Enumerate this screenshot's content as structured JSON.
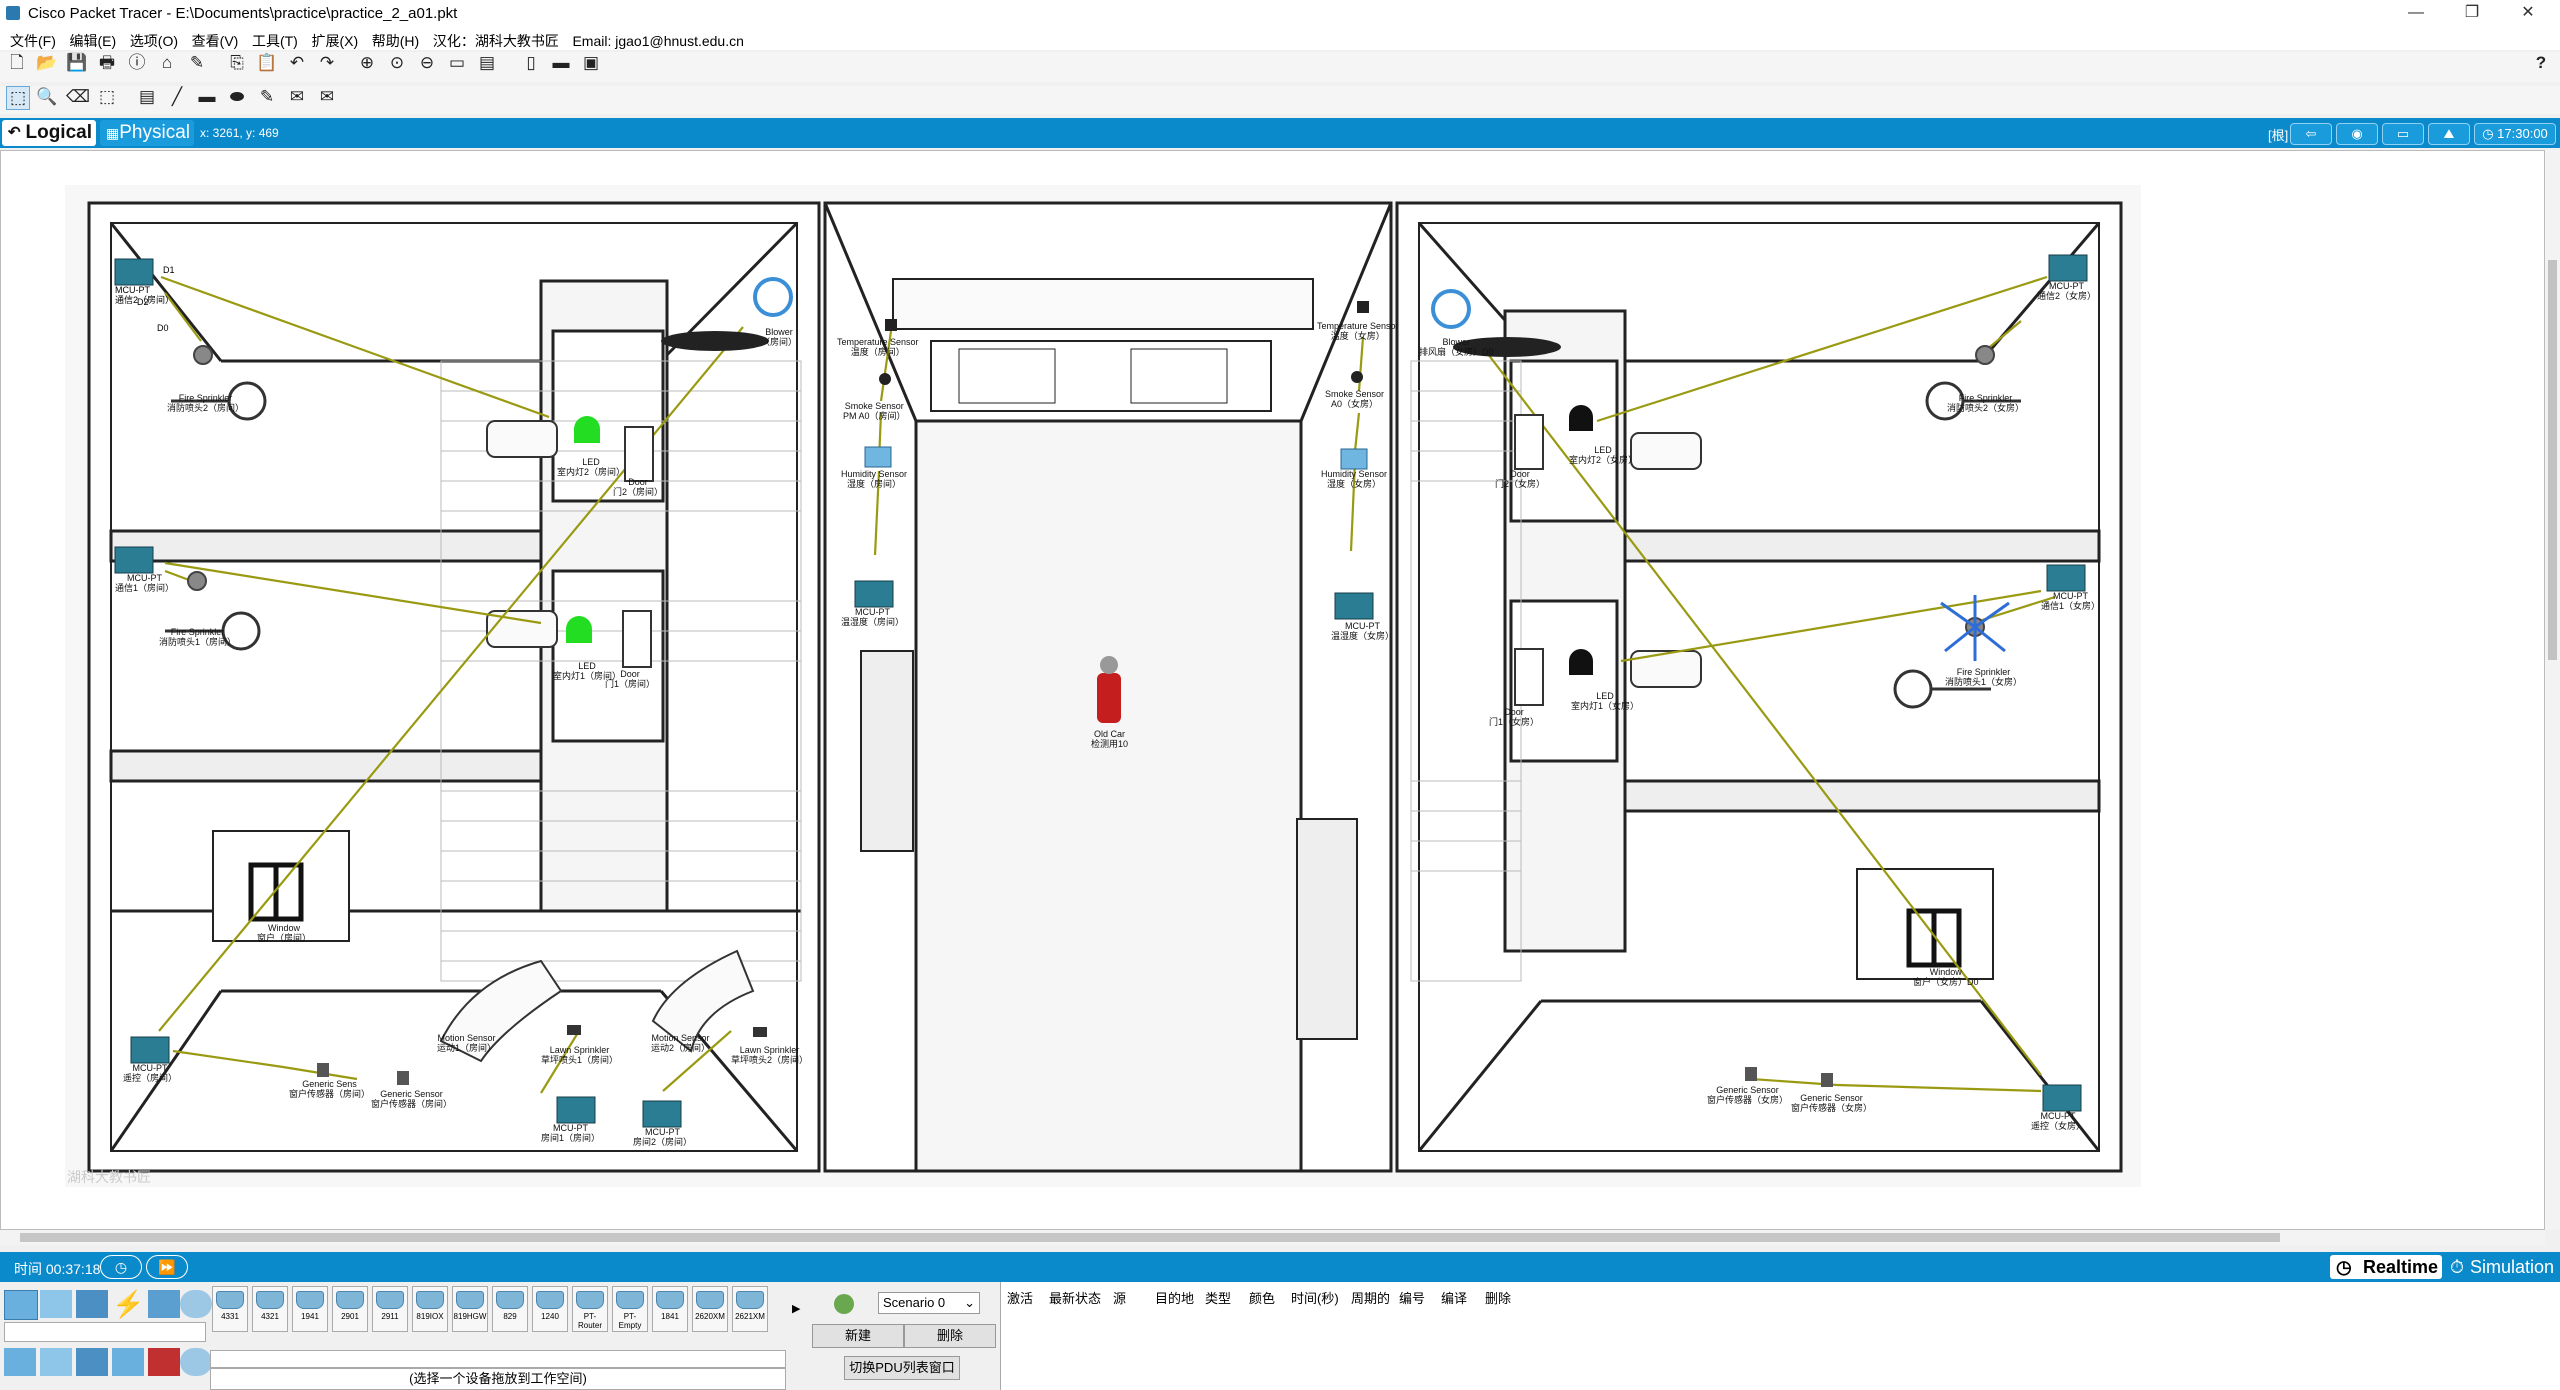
{
  "window": {
    "title": "Cisco Packet Tracer - E:\\Documents\\practice\\practice_2_a01.pkt",
    "minimize": "—",
    "maximize": "❐",
    "close": "✕"
  },
  "menu": [
    "文件(F)",
    "编辑(E)",
    "选项(O)",
    "查看(V)",
    "工具(T)",
    "扩展(X)",
    "帮助(H)",
    "汉化：湖科大教书匠",
    "Email: jgao1@hnust.edu.cn"
  ],
  "help_label": "?",
  "mode": {
    "logical": "Logical",
    "physical": "Physical",
    "coords": "x: 3261, y: 469",
    "right_label": "[根]",
    "clock": "17:30:00"
  },
  "devices": {
    "left": [
      {
        "label": "MCU-PT",
        "sub": "MCU-PT\n通信2（房间）"
      },
      {
        "label": "D1"
      },
      {
        "label": "D2"
      },
      {
        "label": "D0"
      }
    ],
    "labels": {
      "fire_sprinkler_2_bed": "Fire Sprinkler\n消防喷头2（房间）",
      "fire_sprinkler_1_bed": "Fire Sprinkler\n消防喷头1（房间）",
      "led_2_bed": "LED\n室内灯2（房间）",
      "led_1_bed": "LED\n室内灯1（房间）",
      "door_2_bed": "Door\n门2（房间）",
      "door_1_bed": "Door\n门1（房间）",
      "blower_bed": "Blower\n（房间）",
      "window_bed": "Window\n窗户（房间）",
      "mcu_bed": "MCU-PT\n遥控（房间）",
      "mcu1_bed": "MCU-PT\n通信1（房间）",
      "generic_sens_1": "Generic Sens\n窗户传感器（房间）",
      "generic_sensor_2": "Generic Sensor\n窗户传感器（房间）",
      "motion_1": "Motion Sensor\n运动1（房间）",
      "motion_2": "Motion Sensor\n运动2（房间）",
      "lawn_1": "Lawn Sprinkler\n草坪喷头1（房间）",
      "lawn_2": "Lawn Sprinkler\n草坪喷头2（房间）",
      "mcu_gate_1": "MCU-PT\n房间1（房间）",
      "mcu_gate_2": "MCU-PT\n房间2（房间）",
      "temp_l": "Temperature Sensor\n温度（房间）",
      "smoke_l": "Smoke Sensor\nPM A0（房间）",
      "humidity_l": "Humidity Sensor\n湿度（房间）",
      "mcu_mid_l": "MCU-PT\n温湿度（房间）",
      "old_car": "Old Car\n检测用10",
      "temp_r": "Temperature Sensor\n温度（女房）",
      "smoke_r": "Smoke Sensor\nA0（女房）",
      "humidity_r": "Humidity Sensor\n湿度（女房）",
      "mcu_mid_r": "MCU-PT\n温湿度（女房）",
      "blower_r": "Blower\n排风扇（女房）D0",
      "mcu_r_top": "MCU-PT\n通信2（女房）",
      "fire_r_top": "Fire Sprinkler\n消防喷头2（女房）",
      "led_r_2": "LED\n室内灯2（女房）",
      "door_r_2": "Door\n门2（女房）",
      "mcu_r_mid": "MCU-PT\n通信1（女房）",
      "fire_r_1": "Fire Sprinkler\n消防喷头1（女房）",
      "led_r_1": "LED\n室内灯1（女房）",
      "door_r_1": "Door\n门1（女房）",
      "window_r": "Window\n窗户（女房）D0",
      "generic_r_1": "Generic Sensor\n窗户传感器（女房）",
      "generic_r_2": "Generic Sensor\n窗户传感器（女房）",
      "mcu_r_bottom": "MCU-PT\n遥控（女房）",
      "watermark": "湖科大教书匠"
    }
  },
  "status": {
    "time": "时间 00:37:18",
    "realtime": "Realtime",
    "simulation": "Simulation"
  },
  "device_list": [
    "4331",
    "4321",
    "1941",
    "2901",
    "2911",
    "819IOX",
    "819HGW",
    "829",
    "1240",
    "PT-Router",
    "PT-Empty",
    "1841",
    "2620XM",
    "2621XM"
  ],
  "device_hint": "(选择一个设备拖放到工作空间)",
  "scenario": {
    "select": "Scenario 0",
    "new": "新建",
    "delete": "删除",
    "toggle": "切换PDU列表窗口"
  },
  "pdu_columns": [
    "激活",
    "最新状态",
    "源",
    "目的地",
    "类型",
    "颜色",
    "时间(秒)",
    "周期的",
    "编号",
    "编译",
    "删除"
  ]
}
